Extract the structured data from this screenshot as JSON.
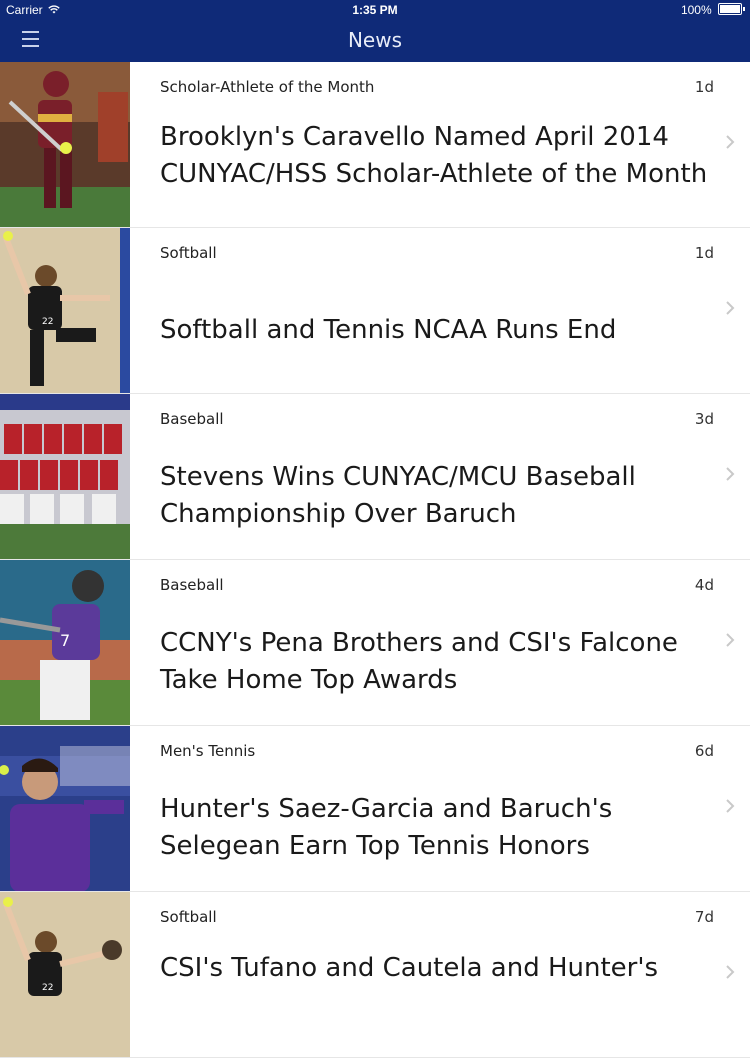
{
  "status_bar": {
    "carrier": "Carrier",
    "time": "1:35 PM",
    "battery": "100%"
  },
  "nav": {
    "title": "News",
    "menu_icon": "hamburger-menu-icon"
  },
  "colors": {
    "nav_bg": "#0f2a78",
    "divider": "#e6e6e6",
    "chevron": "#c9c9c9"
  },
  "items": [
    {
      "category": "Scholar-Athlete of the Month",
      "age": "1d",
      "title": "Brooklyn's Caravello Named April 2014 CUNYAC/HSS Scholar-Athlete of the Month",
      "thumb_icon": "softball-batter-photo"
    },
    {
      "category": "Softball",
      "age": "1d",
      "title": "Softball and Tennis NCAA Runs End",
      "thumb_icon": "softball-pitcher-photo"
    },
    {
      "category": "Baseball",
      "age": "3d",
      "title": "Stevens Wins CUNYAC/MCU Baseball Championship Over Baruch",
      "thumb_icon": "baseball-team-photo"
    },
    {
      "category": "Baseball",
      "age": "4d",
      "title": "CCNY's Pena Brothers and CSI's Falcone Take Home Top Awards",
      "thumb_icon": "baseball-batter-photo"
    },
    {
      "category": "Men's Tennis",
      "age": "6d",
      "title": "Hunter's Saez-Garcia and Baruch's Selegean Earn Top Tennis Honors",
      "thumb_icon": "tennis-player-photo"
    },
    {
      "category": "Softball",
      "age": "7d",
      "title": "CSI's Tufano and Cautela and Hunter's",
      "thumb_icon": "softball-pitcher-photo"
    }
  ]
}
